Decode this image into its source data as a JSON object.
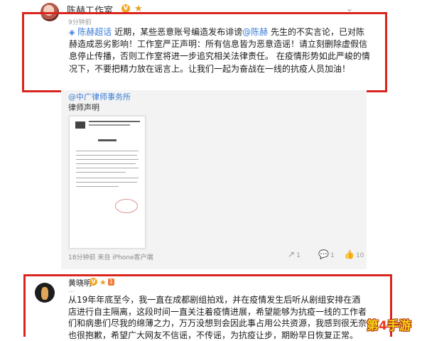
{
  "post1": {
    "author": "陈赫工作室",
    "time": "9分钟前",
    "topic_link": "陈赫超话",
    "text_a": " 近期，某些恶意账号编造发布诽谤",
    "mention": "@陈赫",
    "text_b": " 先生的不实言论，已对陈赫造成恶劣影响！工作室严正声明：所有信息皆为恶意造谣！请立刻删除虚假信息停止传播，否则工作室将进一步追究相关法律责任。 在疫情形势如此严峻的情况下，不要把精力放在谣言上。让我们一起为奋战在一线的抗疫人员加油！"
  },
  "repost": {
    "author": "@中广律师事务所",
    "text": "律师声明",
    "doc_header": "北京市中广律师事务所",
    "meta": "18分钟前 来自 iPhone客户端",
    "actions": [
      {
        "icon": "↗",
        "count": "1"
      },
      {
        "icon": "💬",
        "count": "1"
      },
      {
        "icon": "👍",
        "count": "10"
      }
    ]
  },
  "post2": {
    "author": "黄晓明",
    "level": "1",
    "time": "...",
    "text": "从19年年底至今，我一直在成都剧组拍戏，并在疫情发生后听从剧组安排在酒店进行自主隔离，这段时间一直关注着疫情进展，希望能够为抗疫一线的工作者们和病患们尽我的绵薄之力，万万没想到会因此事占用公共资源，我感到很无奈也很抱歉，希望广大网友不信谣，不传谣，为抗疫让步，期盼早日恢复正常。"
  },
  "watermark": {
    "a": "第",
    "n": "4",
    "b": "手游"
  }
}
